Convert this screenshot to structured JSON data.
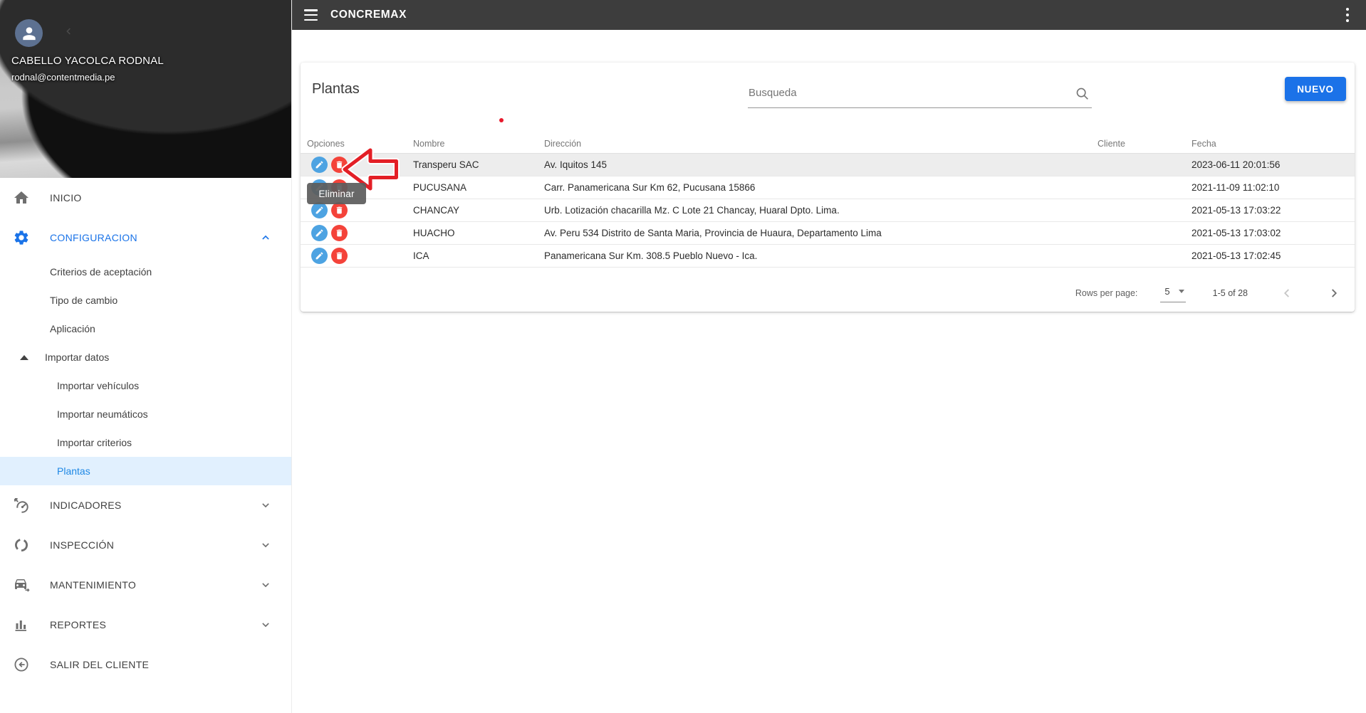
{
  "topbar": {
    "title": "CONCREMAX"
  },
  "profile": {
    "name": "CABELLO YACOLCA RODNAL",
    "email": "rodnal@contentmedia.pe"
  },
  "sidebar": {
    "items": [
      {
        "label": "INICIO",
        "icon": "home-icon",
        "level": "top"
      },
      {
        "label": "CONFIGURACION",
        "icon": "gear-icon",
        "level": "top",
        "active": true,
        "expanded": true
      },
      {
        "label": "Criterios de aceptación",
        "level": "sub"
      },
      {
        "label": "Tipo de cambio",
        "level": "sub"
      },
      {
        "label": "Aplicación",
        "level": "sub"
      },
      {
        "label": "Importar datos",
        "level": "sub",
        "icon": "triangle-up-icon",
        "expanded": true
      },
      {
        "label": "Importar vehículos",
        "level": "sub2"
      },
      {
        "label": "Importar neumáticos",
        "level": "sub2"
      },
      {
        "label": "Importar criterios",
        "level": "sub2"
      },
      {
        "label": "Plantas",
        "level": "sub2",
        "selected": true
      },
      {
        "label": "INDICADORES",
        "icon": "gauge-icon",
        "level": "top",
        "collapsible": true
      },
      {
        "label": "INSPECCIÓN",
        "icon": "inspection-icon",
        "level": "top",
        "collapsible": true
      },
      {
        "label": "MANTENIMIENTO",
        "icon": "car-icon",
        "level": "top",
        "collapsible": true
      },
      {
        "label": "REPORTES",
        "icon": "bar-chart-icon",
        "level": "top",
        "collapsible": true
      },
      {
        "label": "SALIR DEL CLIENTE",
        "icon": "exit-icon",
        "level": "top"
      }
    ]
  },
  "main": {
    "title": "Plantas",
    "search": {
      "placeholder": "Busqueda",
      "value": ""
    },
    "new_button": "NUEVO",
    "table": {
      "columns": [
        "Opciones",
        "Nombre",
        "Dirección",
        "Cliente",
        "Fecha"
      ],
      "rows": [
        {
          "nombre": "Transperu SAC",
          "direccion": "Av. Iquitos 145",
          "cliente": "",
          "fecha": "2023-06-11 20:01:56",
          "highlighted": true
        },
        {
          "nombre": "PUCUSANA",
          "direccion": "Carr. Panamericana Sur Km 62, Pucusana 15866",
          "cliente": "",
          "fecha": "2021-11-09 11:02:10",
          "highlighted": false
        },
        {
          "nombre": "CHANCAY",
          "direccion": "Urb. Lotización chacarilla Mz. C Lote 21 Chancay, Huaral Dpto. Lima.",
          "cliente": "",
          "fecha": "2021-05-13 17:03:22",
          "highlighted": false
        },
        {
          "nombre": "HUACHO",
          "direccion": "Av. Peru 534 Distrito de Santa Maria, Provincia de Huaura, Departamento Lima",
          "cliente": "",
          "fecha": "2021-05-13 17:03:02",
          "highlighted": false
        },
        {
          "nombre": "ICA",
          "direccion": "Panamericana Sur Km. 308.5 Pueblo Nuevo - Ica.",
          "cliente": "",
          "fecha": "2021-05-13 17:02:45",
          "highlighted": false
        }
      ]
    },
    "pagination": {
      "rows_per_page_label": "Rows per page:",
      "rows_per_page_value": "5",
      "range_label": "1-5 of 28"
    },
    "tooltip": "Eliminar"
  },
  "colors": {
    "topbar_bg": "#3d3d3d",
    "accent_blue": "#1b72e8",
    "sidebar_active_blue": "#1e88e5",
    "sidebar_active_bg": "#e1f0fe",
    "edit_button_blue": "#4da3e2",
    "delete_button_red": "#f4433a",
    "annotation_red": "#e8192c",
    "row_highlight": "#ededed"
  }
}
